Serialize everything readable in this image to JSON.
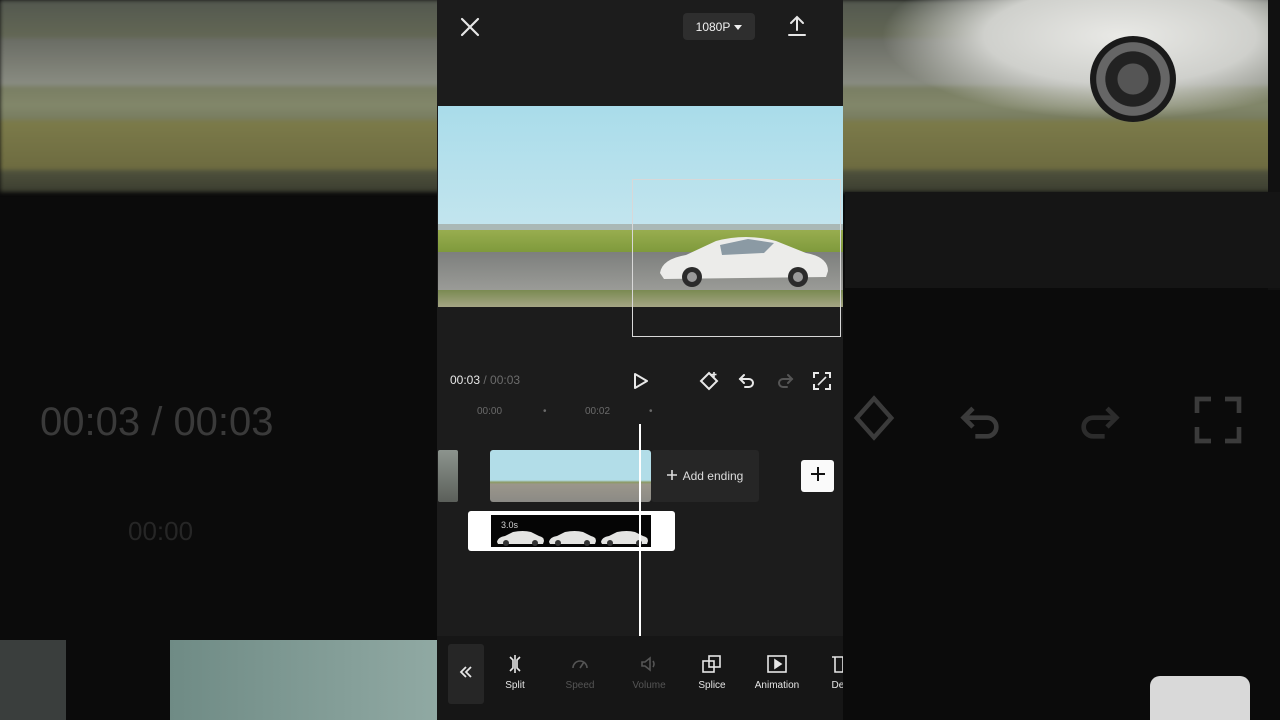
{
  "top_bar": {
    "resolution_label": "1080P",
    "icons": [
      "close-icon",
      "export-icon",
      "chevron-down-icon"
    ]
  },
  "player": {
    "current_time": "00:03",
    "duration": " / 00:03"
  },
  "timeline": {
    "ruler_labels": [
      "00:00",
      "00:02"
    ],
    "add_ending_label": "Add ending",
    "overlay_label": "3.0s"
  },
  "toolbar": {
    "items": [
      {
        "label": "Split"
      },
      {
        "label": "Speed"
      },
      {
        "label": "Volume"
      },
      {
        "label": "Splice"
      },
      {
        "label": "Animation"
      },
      {
        "label": "Del"
      }
    ]
  },
  "background": {
    "mirror_time": "00:03 / 00:03",
    "mirror_ruler": "00:00"
  },
  "colors": {
    "panel": "#1c1c1c",
    "toolbar": "#161616",
    "accent_white": "#ffffff",
    "dim_text": "#6c6c6c"
  }
}
